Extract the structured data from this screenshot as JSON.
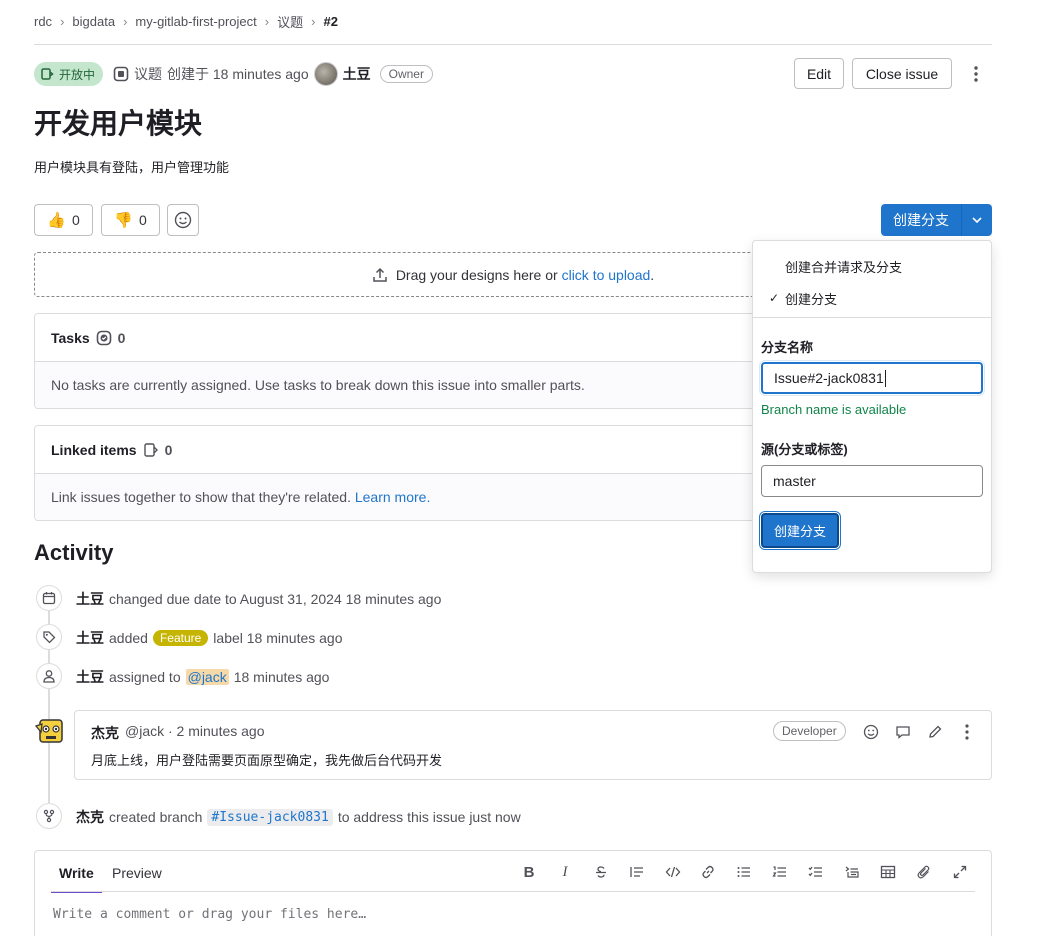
{
  "breadcrumb": {
    "items": [
      "rdc",
      "bigdata",
      "my-gitlab-first-project",
      "议题",
      "#2"
    ]
  },
  "issue": {
    "status": "开放中",
    "type_label": "议题",
    "created_text": "创建于 18 minutes ago",
    "author": "土豆",
    "author_role": "Owner",
    "title": "开发用户模块",
    "description": "用户模块具有登陆，用户管理功能"
  },
  "header_actions": {
    "edit": "Edit",
    "close": "Close issue"
  },
  "reactions": {
    "thumbs_up_count": "0",
    "thumbs_down_count": "0"
  },
  "create_branch": {
    "button": "创建分支",
    "menu": {
      "option_mr": "创建合并请求及分支",
      "option_branch": "创建分支",
      "selected": "创建分支",
      "branch_name_label": "分支名称",
      "branch_name_value": "Issue#2-jack0831",
      "availability": "Branch name is available",
      "source_label": "源(分支或标签)",
      "source_value": "master",
      "submit": "创建分支"
    }
  },
  "upload": {
    "text": "Drag your designs here or",
    "link": "click to upload",
    "suffix": "."
  },
  "tasks": {
    "title": "Tasks",
    "count": "0",
    "empty": "No tasks are currently assigned. Use tasks to break down this issue into smaller parts."
  },
  "linked": {
    "title": "Linked items",
    "count": "0",
    "empty": "Link issues together to show that they're related.",
    "learn_more": "Learn more."
  },
  "activity": {
    "title": "Activity",
    "events": [
      {
        "author": "土豆",
        "text": "changed due date to August 31, 2024 18 minutes ago",
        "icon": "calendar-icon"
      },
      {
        "author": "土豆",
        "pre": "added",
        "label": "Feature",
        "post": "label 18 minutes ago",
        "icon": "label-icon"
      },
      {
        "author": "土豆",
        "pre": "assigned to",
        "mention": "@jack",
        "post": "18 minutes ago",
        "icon": "user-icon"
      },
      {
        "author": "杰克",
        "pre": "created branch",
        "ref": "#Issue-jack0831",
        "post": "to address this issue just now",
        "icon": "branch-icon"
      }
    ],
    "comment": {
      "author": "杰克",
      "handle": "@jack · 2 minutes ago",
      "role": "Developer",
      "body": "月底上线，用户登陆需要页面原型确定，我先做后台代码开发"
    }
  },
  "editor": {
    "tab_write": "Write",
    "tab_preview": "Preview",
    "placeholder": "Write a comment or drag your files here…",
    "tools": [
      "B",
      "I"
    ]
  },
  "colors": {
    "primary": "#1f75cb",
    "status_bg": "#c3e6cd",
    "status_fg": "#24663b",
    "feature_label": "#c5b400",
    "success": "#108548"
  }
}
